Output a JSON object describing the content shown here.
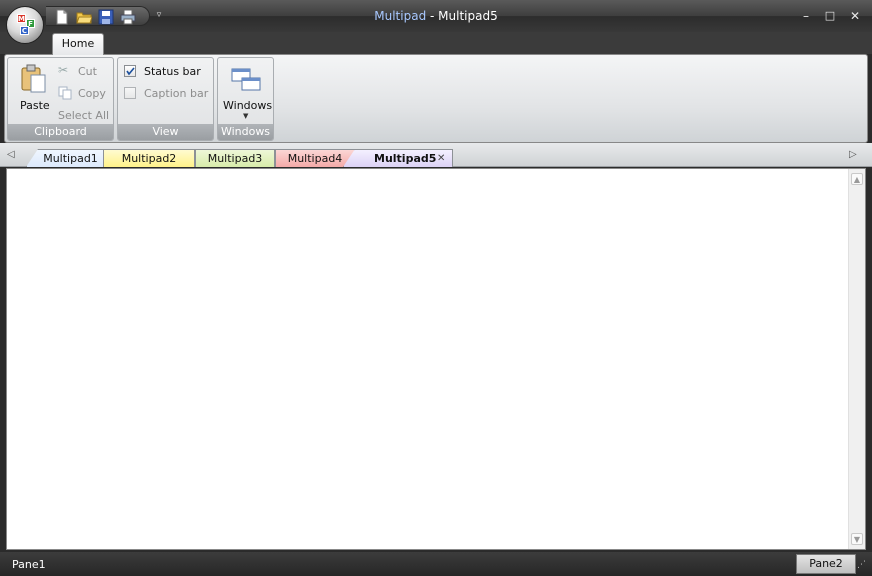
{
  "window": {
    "app_name": "Multipad",
    "separator": " - ",
    "doc_name": "Multipad5",
    "controls": {
      "minimize": "–",
      "maximize": "□",
      "close": "✕"
    }
  },
  "app_button": {
    "letters": [
      "M",
      "F",
      "C"
    ]
  },
  "quick_access": {
    "more": "▿"
  },
  "ribbon": {
    "tabs": [
      {
        "label": "Home",
        "active": true
      }
    ],
    "groups": {
      "clipboard": {
        "label": "Clipboard",
        "paste": "Paste",
        "cut": "Cut",
        "copy": "Copy",
        "select_all": "Select All"
      },
      "view": {
        "label": "View",
        "status_bar": "Status bar",
        "status_bar_checked": true,
        "caption_bar": "Caption bar",
        "caption_bar_checked": false
      },
      "windows": {
        "label": "Windows",
        "windows_button": "Windows"
      }
    }
  },
  "doc_tabs": [
    {
      "label": "Multipad1",
      "color": "#dce9fb",
      "active": false
    },
    {
      "label": "Multipad2",
      "color": "#fff28a",
      "active": false
    },
    {
      "label": "Multipad3",
      "color": "#d8ecaa",
      "active": false
    },
    {
      "label": "Multipad4",
      "color": "#f4aaa8",
      "active": false
    },
    {
      "label": "Multipad5",
      "color": "#dcd2f5",
      "active": true,
      "close": "✕"
    }
  ],
  "tab_nav": {
    "left": "◁",
    "right": "▷"
  },
  "scroll": {
    "up": "▲",
    "down": "▼"
  },
  "status_bar": {
    "pane1": "Pane1",
    "pane2": "Pane2",
    "grip": "⋰"
  }
}
